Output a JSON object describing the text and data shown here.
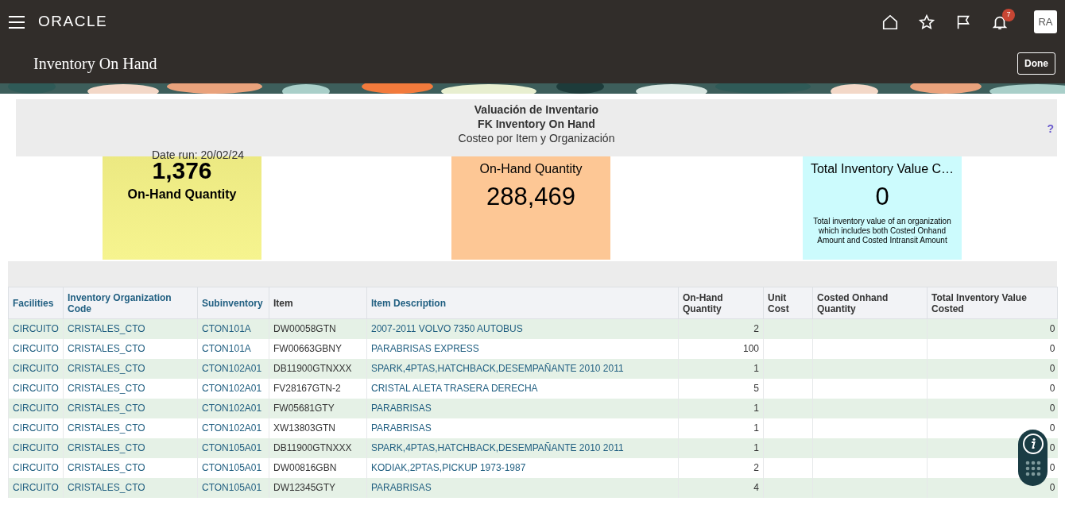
{
  "topbar": {
    "brand": "ORACLE",
    "notifications": "7",
    "avatar": "RA"
  },
  "page": {
    "title": "Inventory On Hand",
    "done": "Done"
  },
  "report": {
    "titles": [
      "Valuación de Inventario",
      "FK Inventory On Hand",
      "Costeo por Item y Organización"
    ],
    "help": "?",
    "date_run": "Date run: 20/02/24"
  },
  "tiles": [
    {
      "kind": "value-first",
      "color": "#f6f48f",
      "value": "1,376",
      "label": "On-Hand Quantity"
    },
    {
      "kind": "label-first",
      "color": "#fdc795",
      "label": "On-Hand Quantity",
      "value": "288,469"
    },
    {
      "kind": "label-first",
      "color": "#ccfbfd",
      "label": "Total Inventory Value C…",
      "value": "0",
      "description": "Total inventory value of an organization which includes both Costed Onhand Amount and Costed Intransit Amount"
    }
  ],
  "table": {
    "columns": [
      {
        "label": "Facilities",
        "link": true,
        "kind": "text"
      },
      {
        "label": "Inventory Organization Code",
        "link": true,
        "kind": "text"
      },
      {
        "label": "Subinventory",
        "link": true,
        "kind": "text"
      },
      {
        "label": "Item",
        "link": false,
        "kind": "text"
      },
      {
        "label": "Item Description",
        "link": true,
        "kind": "text"
      },
      {
        "label": "On-Hand Quantity",
        "link": false,
        "kind": "number"
      },
      {
        "label": "Unit Cost",
        "link": false,
        "kind": "number"
      },
      {
        "label": "Costed Onhand Quantity",
        "link": false,
        "kind": "number"
      },
      {
        "label": "Total Inventory Value Costed",
        "link": false,
        "kind": "number"
      }
    ],
    "rows": [
      [
        "CIRCUITO",
        "CRISTALES_CTO",
        "CTON101A",
        "DW00058GTN",
        "2007-2011 VOLVO 7350 AUTOBUS",
        "2",
        "",
        "",
        "0"
      ],
      [
        "CIRCUITO",
        "CRISTALES_CTO",
        "CTON101A",
        "FW00663GBNY",
        "PARABRISAS EXPRESS",
        "100",
        "",
        "",
        "0"
      ],
      [
        "CIRCUITO",
        "CRISTALES_CTO",
        "CTON102A01",
        "DB11900GTNXXX",
        "SPARK,4PTAS,HATCHBACK,DESEMPAÑANTE 2010 2011",
        "1",
        "",
        "",
        "0"
      ],
      [
        "CIRCUITO",
        "CRISTALES_CTO",
        "CTON102A01",
        "FV28167GTN-2",
        "CRISTAL ALETA TRASERA DERECHA",
        "5",
        "",
        "",
        "0"
      ],
      [
        "CIRCUITO",
        "CRISTALES_CTO",
        "CTON102A01",
        "FW05681GTY",
        "PARABRISAS",
        "1",
        "",
        "",
        "0"
      ],
      [
        "CIRCUITO",
        "CRISTALES_CTO",
        "CTON102A01",
        "XW13803GTN",
        "PARABRISAS",
        "1",
        "",
        "",
        "0"
      ],
      [
        "CIRCUITO",
        "CRISTALES_CTO",
        "CTON105A01",
        "DB11900GTNXXX",
        "SPARK,4PTAS,HATCHBACK,DESEMPAÑANTE 2010 2011",
        "1",
        "",
        "",
        "0"
      ],
      [
        "CIRCUITO",
        "CRISTALES_CTO",
        "CTON105A01",
        "DW00816GBN",
        "KODIAK,2PTAS,PICKUP 1973-1987",
        "2",
        "",
        "",
        "0"
      ],
      [
        "CIRCUITO",
        "CRISTALES_CTO",
        "CTON105A01",
        "DW12345GTY",
        "PARABRISAS",
        "4",
        "",
        "",
        "0"
      ]
    ]
  }
}
